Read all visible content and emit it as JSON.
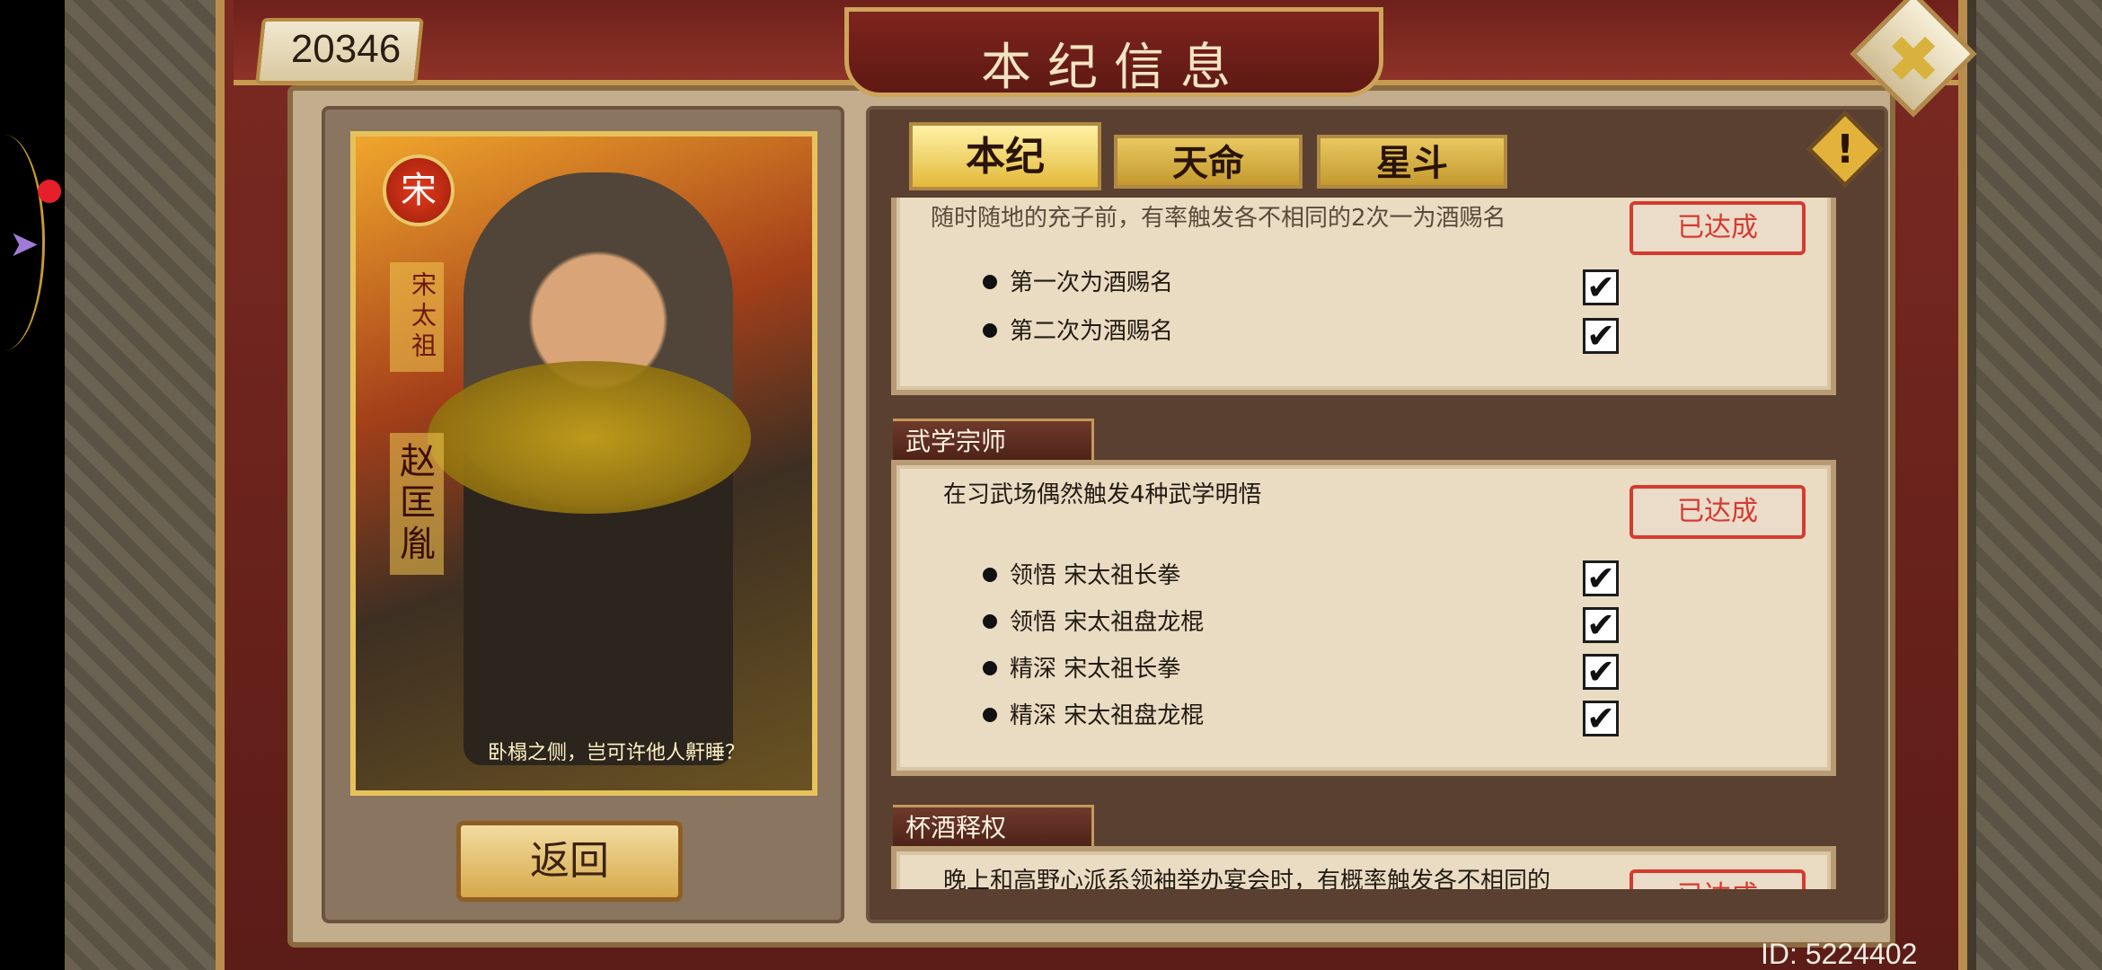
{
  "header": {
    "title": "本纪信息",
    "score": "20346"
  },
  "tabs": [
    {
      "label": "本纪",
      "active": true
    },
    {
      "label": "天命",
      "active": false
    },
    {
      "label": "星斗",
      "active": false
    }
  ],
  "hero_card": {
    "seal_char": "宋",
    "title_vertical": "宋太祖",
    "name_vertical": "赵匡胤",
    "quote": "卧榻之侧，岂可许他人鼾睡？"
  },
  "back_button": "返回",
  "entries": [
    {
      "title": "",
      "description": "随时随地的充子前，有率触发各不相同的2次一为酒赐名",
      "status": "已达成",
      "requirements": [
        {
          "label": "第一次为酒赐名",
          "done": true
        },
        {
          "label": "第二次为酒赐名",
          "done": true
        }
      ]
    },
    {
      "title": "武学宗师",
      "description": "在习武场偶然触发4种武学明悟",
      "status": "已达成",
      "requirements": [
        {
          "label": "领悟 宋太祖长拳",
          "done": true
        },
        {
          "label": "领悟 宋太祖盘龙棍",
          "done": true
        },
        {
          "label": "精深 宋太祖长拳",
          "done": true
        },
        {
          "label": "精深 宋太祖盘龙棍",
          "done": true
        }
      ]
    },
    {
      "title": "杯酒释权",
      "description": "晚上和高野心派系领袖举办宴会时，有概率触发各不相同的",
      "status": "已达成",
      "requirements": []
    }
  ],
  "footer": {
    "id_text": "ID: 5224402"
  },
  "check_mark": "✔",
  "close_symbol": "✖",
  "info_symbol": "!"
}
